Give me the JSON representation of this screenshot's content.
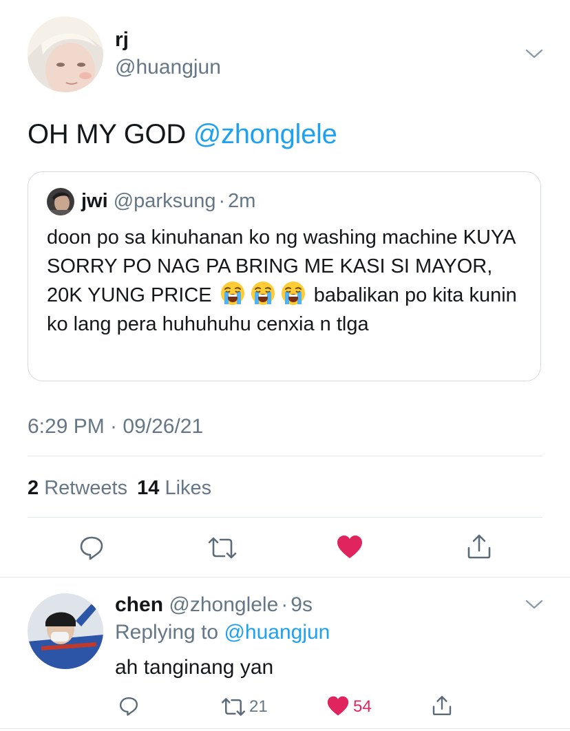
{
  "main_tweet": {
    "author_name": "rj",
    "author_handle": "@huangjun",
    "text_plain": "OH MY GOD ",
    "text_mention": "@zhonglele",
    "quote": {
      "author_name": "jwi",
      "author_handle": "@parksung",
      "separator": "·",
      "time_ago": "2m",
      "text_part1": "doon po sa kinuhanan ko ng washing machine KUYA SORRY PO NAG PA BRING ME KASI SI MAYOR, 20K YUNG PRICE",
      "emoji_name": "loudly-crying-face",
      "text_part2": "babalikan po kita kunin ko lang pera huhuhuhu cenxia n tlga"
    },
    "timestamp": "6:29 PM · 09/26/21",
    "stats": {
      "retweets_count": "2",
      "retweets_label": "Retweets",
      "likes_count": "14",
      "likes_label": "Likes"
    },
    "actions": [
      "reply-icon",
      "retweet-icon",
      "like-icon-filled",
      "share-icon"
    ]
  },
  "reply_tweet": {
    "author_name": "chen",
    "author_handle": "@zhonglele",
    "separator": "·",
    "time_ago": "9s",
    "replying_to_label": "Replying to",
    "replying_to_handle": "@huangjun",
    "text": "ah tanginang yan",
    "retweet_count": "21",
    "like_count": "54"
  },
  "colors": {
    "link_blue": "#1da1f2",
    "like_red": "#e0245e",
    "text_gray": "#657786",
    "divider": "#e1e6ea"
  }
}
